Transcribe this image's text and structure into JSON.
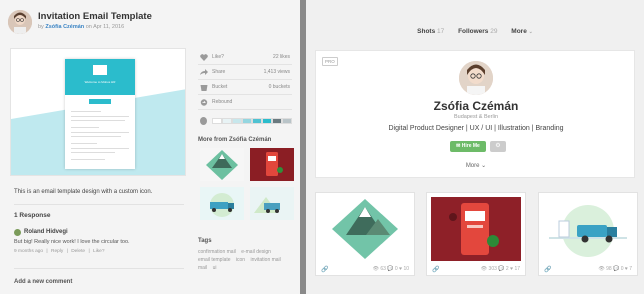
{
  "shot": {
    "title": "Invitation Email Template",
    "by": "by",
    "author": "Zsófia Czémán",
    "on": "on",
    "date": "Apr 11, 2016",
    "preview": {
      "welcome": "Welcome to Mobus HR",
      "accent": "#2bbccc"
    },
    "description": "This is an email template design with a custom icon."
  },
  "stats": [
    {
      "label": "Like?",
      "value": "22 likes",
      "icon": "heart-icon"
    },
    {
      "label": "Share",
      "value": "1,413 views",
      "icon": "share-icon"
    },
    {
      "label": "Bucket",
      "value": "0 buckets",
      "icon": "bucket-icon"
    },
    {
      "label": "Rebound",
      "value": "",
      "icon": "rebound-icon"
    }
  ],
  "palette": [
    "#ffffff",
    "#e8f3f5",
    "#c7e7ec",
    "#94d6e0",
    "#4fc2d2",
    "#2bbccc",
    "#6a7a80",
    "#b9c4c8"
  ],
  "more_from": "More from Zsófia Czémán",
  "responses": {
    "heading": "1 Response",
    "author": "Roland Hidvegi",
    "text": "But big! Really nice work! I love the circular too.",
    "meta": [
      "9 months ago",
      "|",
      "Reply",
      "|",
      "Delete",
      "|",
      "Like?"
    ]
  },
  "add_comment": "Add a new comment",
  "tags": {
    "heading": "Tags",
    "items": [
      "confirmation mail",
      "e-mail design",
      "email template",
      "icon",
      "invitation mail",
      "mail",
      "ui"
    ]
  },
  "profile": {
    "tabs": [
      {
        "label": "Shots",
        "count": "17"
      },
      {
        "label": "Followers",
        "count": "29"
      },
      {
        "label": "More",
        "count": ""
      }
    ],
    "pro_badge": "PRO",
    "name": "Zsófia Czémán",
    "location": "Budapest & Berlin",
    "bio": "Digital Product Designer | UX / UI | Illustration | Branding",
    "hire": "Hire Me",
    "more": "More"
  },
  "profile_shots": [
    {
      "views": "63",
      "comments": "0",
      "likes": "10"
    },
    {
      "views": "303",
      "comments": "2",
      "likes": "17"
    },
    {
      "views": "98",
      "comments": "0",
      "likes": "7"
    }
  ]
}
